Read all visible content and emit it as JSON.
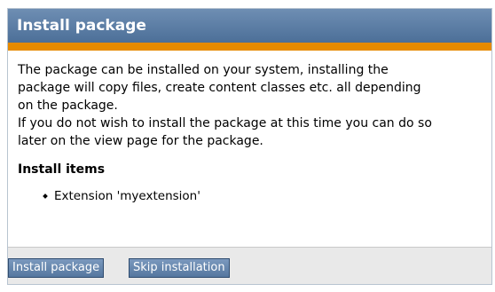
{
  "window": {
    "title": "Install package"
  },
  "colors": {
    "title_bar": "#5a7ca6",
    "accent_stripe": "#e68a00",
    "button": "#6686ad",
    "footer": "#e9e9e9"
  },
  "intro": {
    "lines": [
      "The package can be installed on your system, installing the",
      "package will copy files, create content classes etc. all depending",
      "on the package.",
      "If you do not wish to install the package at this time you can do so",
      "later on the view page for the package."
    ]
  },
  "install_items": {
    "heading": "Install items",
    "items": [
      "Extension 'myextension'"
    ]
  },
  "buttons": {
    "install_label": "Install package",
    "skip_label": "Skip installation"
  }
}
